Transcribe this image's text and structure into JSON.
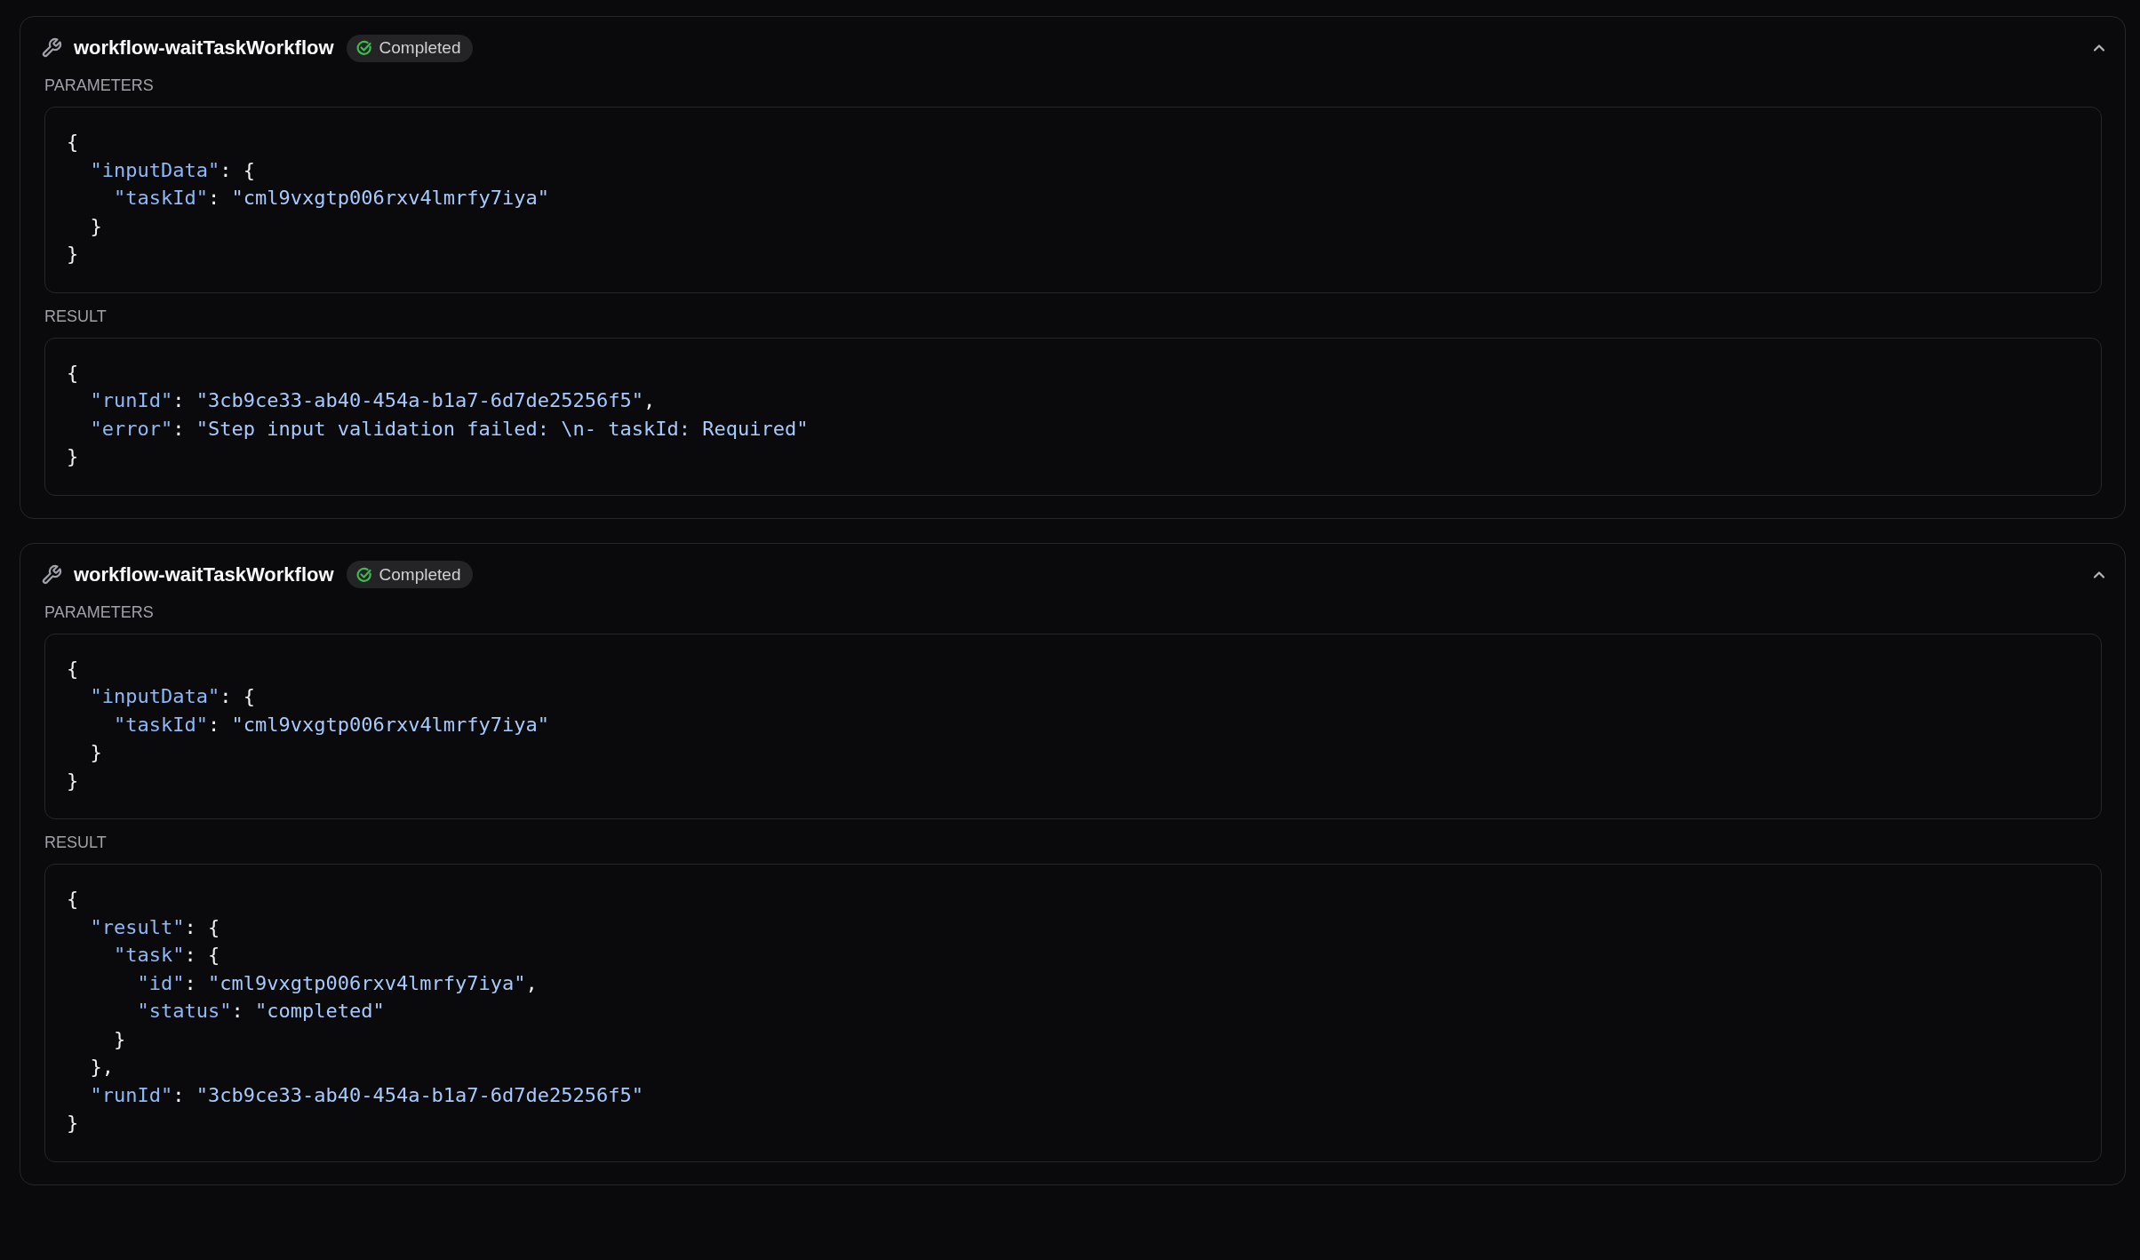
{
  "cards": [
    {
      "tool_name": "workflow-waitTaskWorkflow",
      "status": {
        "label": "Completed",
        "kind": "success"
      },
      "expanded": true,
      "sections": [
        {
          "label": "PARAMETERS",
          "lines": [
            [
              {
                "kind": "punct",
                "text": "{"
              }
            ],
            [
              {
                "kind": "key",
                "text": "  \"inputData\""
              },
              {
                "kind": "punct",
                "text": ": {"
              }
            ],
            [
              {
                "kind": "key",
                "text": "    \"taskId\""
              },
              {
                "kind": "punct",
                "text": ": "
              },
              {
                "kind": "string",
                "text": "\"cml9vxgtp006rxv4lmrfy7iya\""
              }
            ],
            [
              {
                "kind": "punct",
                "text": "  }"
              }
            ],
            [
              {
                "kind": "punct",
                "text": "}"
              }
            ]
          ]
        },
        {
          "label": "RESULT",
          "lines": [
            [
              {
                "kind": "punct",
                "text": "{"
              }
            ],
            [
              {
                "kind": "key",
                "text": "  \"runId\""
              },
              {
                "kind": "punct",
                "text": ": "
              },
              {
                "kind": "string",
                "text": "\"3cb9ce33-ab40-454a-b1a7-6d7de25256f5\""
              },
              {
                "kind": "punct",
                "text": ","
              }
            ],
            [
              {
                "kind": "key",
                "text": "  \"error\""
              },
              {
                "kind": "punct",
                "text": ": "
              },
              {
                "kind": "string",
                "text": "\"Step input validation failed: \\n- taskId: Required\""
              }
            ],
            [
              {
                "kind": "punct",
                "text": "}"
              }
            ]
          ]
        }
      ]
    },
    {
      "tool_name": "workflow-waitTaskWorkflow",
      "status": {
        "label": "Completed",
        "kind": "success"
      },
      "expanded": true,
      "sections": [
        {
          "label": "PARAMETERS",
          "lines": [
            [
              {
                "kind": "punct",
                "text": "{"
              }
            ],
            [
              {
                "kind": "key",
                "text": "  \"inputData\""
              },
              {
                "kind": "punct",
                "text": ": {"
              }
            ],
            [
              {
                "kind": "key",
                "text": "    \"taskId\""
              },
              {
                "kind": "punct",
                "text": ": "
              },
              {
                "kind": "string",
                "text": "\"cml9vxgtp006rxv4lmrfy7iya\""
              }
            ],
            [
              {
                "kind": "punct",
                "text": "  }"
              }
            ],
            [
              {
                "kind": "punct",
                "text": "}"
              }
            ]
          ]
        },
        {
          "label": "RESULT",
          "lines": [
            [
              {
                "kind": "punct",
                "text": "{"
              }
            ],
            [
              {
                "kind": "key",
                "text": "  \"result\""
              },
              {
                "kind": "punct",
                "text": ": {"
              }
            ],
            [
              {
                "kind": "key",
                "text": "    \"task\""
              },
              {
                "kind": "punct",
                "text": ": {"
              }
            ],
            [
              {
                "kind": "key",
                "text": "      \"id\""
              },
              {
                "kind": "punct",
                "text": ": "
              },
              {
                "kind": "string",
                "text": "\"cml9vxgtp006rxv4lmrfy7iya\""
              },
              {
                "kind": "punct",
                "text": ","
              }
            ],
            [
              {
                "kind": "key",
                "text": "      \"status\""
              },
              {
                "kind": "punct",
                "text": ": "
              },
              {
                "kind": "string",
                "text": "\"completed\""
              }
            ],
            [
              {
                "kind": "punct",
                "text": "    }"
              }
            ],
            [
              {
                "kind": "punct",
                "text": "  },"
              }
            ],
            [
              {
                "kind": "key",
                "text": "  \"runId\""
              },
              {
                "kind": "punct",
                "text": ": "
              },
              {
                "kind": "string",
                "text": "\"3cb9ce33-ab40-454a-b1a7-6d7de25256f5\""
              }
            ],
            [
              {
                "kind": "punct",
                "text": "}"
              }
            ]
          ]
        }
      ]
    }
  ]
}
